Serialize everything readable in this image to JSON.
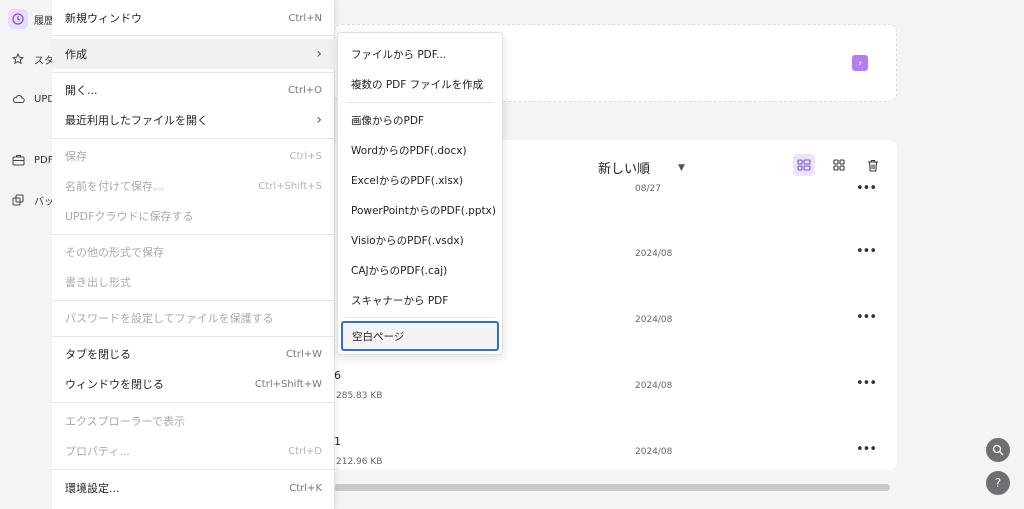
{
  "sidebar": {
    "items": [
      {
        "label": "履歴",
        "icon": "clock-icon"
      },
      {
        "label": "スタ",
        "icon": "star-icon"
      },
      {
        "label": "UPD",
        "icon": "cloud-icon"
      },
      {
        "label": "PDF",
        "icon": "toolbox-icon"
      },
      {
        "label": "バッ",
        "icon": "batch-icon"
      }
    ]
  },
  "filelist": {
    "sort_label": "新しい順",
    "rows": [
      {
        "date": "08/27",
        "name": "",
        "size": ""
      },
      {
        "date": "2024/08",
        "name": "",
        "size": ""
      },
      {
        "date": "2024/08",
        "name": "",
        "size": ""
      },
      {
        "date": "2024/08",
        "name": "6",
        "size": "285.83 KB"
      },
      {
        "date": "2024/08",
        "name": "1",
        "size": "212.96 KB"
      }
    ],
    "more_glyph": "•••"
  },
  "menu": {
    "new_window": {
      "label": "新規ウィンドウ",
      "shortcut": "Ctrl+N"
    },
    "create": {
      "label": "作成"
    },
    "open": {
      "label": "開く...",
      "shortcut": "Ctrl+O"
    },
    "recent": {
      "label": "最近利用したファイルを開く"
    },
    "save": {
      "label": "保存",
      "shortcut": "Ctrl+S"
    },
    "save_as": {
      "label": "名前を付けて保存...",
      "shortcut": "Ctrl+Shift+S"
    },
    "save_cloud": {
      "label": "UPDFクラウドに保存する"
    },
    "save_other": {
      "label": "その他の形式で保存"
    },
    "export": {
      "label": "書き出し形式"
    },
    "password": {
      "label": "パスワードを設定してファイルを保護する"
    },
    "close_tab": {
      "label": "タブを閉じる",
      "shortcut": "Ctrl+W"
    },
    "close_window": {
      "label": "ウィンドウを閉じる",
      "shortcut": "Ctrl+Shift+W"
    },
    "explorer": {
      "label": "エクスプローラーで表示"
    },
    "properties": {
      "label": "プロパティ...",
      "shortcut": "Ctrl+D"
    },
    "preferences": {
      "label": "環境設定...",
      "shortcut": "Ctrl+K"
    }
  },
  "submenu": {
    "items": [
      "ファイルから PDF...",
      "複数の PDF ファイルを作成",
      "画像からのPDF",
      "WordからのPDF(.docx)",
      "ExcelからのPDF(.xlsx)",
      "PowerPointからのPDF(.pptx)",
      "VisioからのPDF(.vsdx)",
      "CAJからのPDF(.caj)",
      "スキャナーから PDF",
      "空白ページ"
    ]
  },
  "colors": {
    "accent": "#b57cf3",
    "selection_border": "#2f6fd6"
  }
}
